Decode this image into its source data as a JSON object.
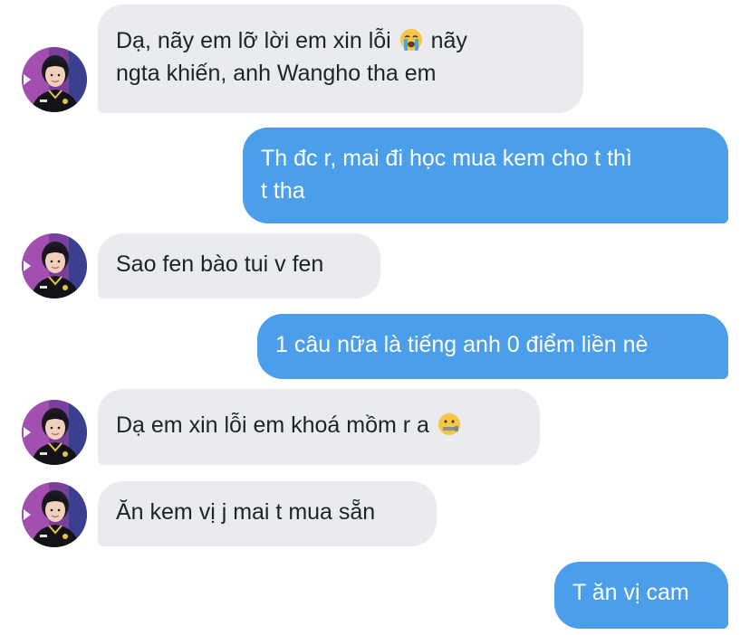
{
  "conversation": {
    "messages": [
      {
        "direction": "incoming",
        "lines": [
          "Dạ, nãy em lỡ lời em xin lỗi 😭  nãy",
          "ngta khiến, anh Wangho tha em"
        ],
        "line_parts": [
          {
            "before": "Dạ, nãy em lỡ lời em xin lỗi",
            "emoji": "loudly-crying-face",
            "after": " nãy"
          },
          {
            "text": "ngta khiến, anh Wangho tha em"
          }
        ]
      },
      {
        "direction": "outgoing",
        "lines": [
          "Th đc r, mai đi học mua kem cho t thì",
          "t tha"
        ]
      },
      {
        "direction": "incoming",
        "lines": [
          "Sao fen bào tui v fen"
        ]
      },
      {
        "direction": "outgoing",
        "lines": [
          "1 câu nữa là tiếng anh 0 điểm liền nè"
        ]
      },
      {
        "direction": "incoming",
        "lines": [
          "Dạ em xin lỗi em khoá mồm r a 🤐"
        ],
        "line_parts": [
          {
            "before": "Dạ em xin lỗi em khoá mồm r a",
            "emoji": "zipper-mouth-face",
            "after": ""
          }
        ]
      },
      {
        "direction": "incoming",
        "lines": [
          "Ăn kem vị j mai t mua sẵn"
        ]
      },
      {
        "direction": "outgoing",
        "lines": [
          "T ăn vị cam"
        ]
      }
    ]
  },
  "theme": {
    "incoming_bubble_color": "#e9ebee",
    "outgoing_bubble_color": "#4a9eea",
    "outgoing_text_color": "#ffffff",
    "incoming_text_color": "#1f2328"
  },
  "icons": {
    "avatar": "contact-avatar-icon",
    "emoji_crying": "loudly-crying-face",
    "emoji_zipper": "zipper-mouth-face"
  }
}
